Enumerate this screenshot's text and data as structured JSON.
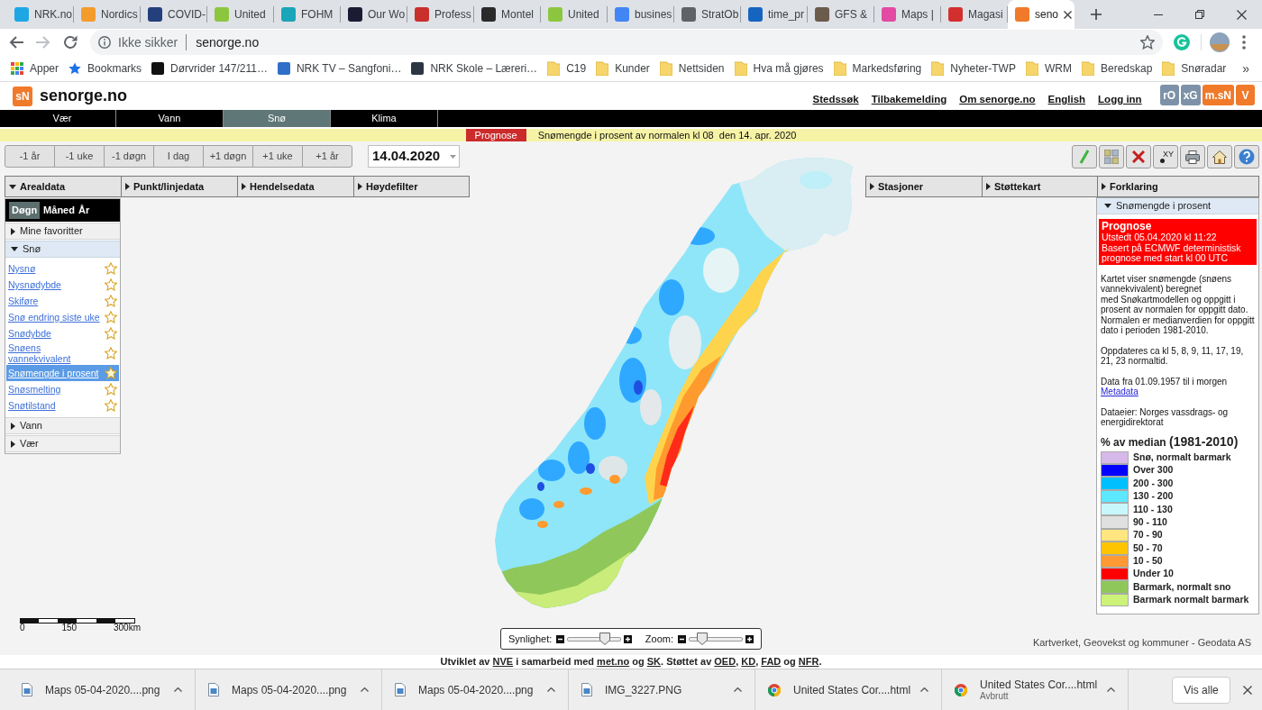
{
  "browser": {
    "tabs": [
      {
        "title": "NRK.no",
        "selected": false
      },
      {
        "title": "Nordics",
        "selected": false
      },
      {
        "title": "COVID-",
        "selected": false
      },
      {
        "title": "United",
        "selected": false
      },
      {
        "title": "FOHM",
        "selected": false
      },
      {
        "title": "Our Wo",
        "selected": false
      },
      {
        "title": "Profess",
        "selected": false
      },
      {
        "title": "Montel",
        "selected": false
      },
      {
        "title": "United",
        "selected": false
      },
      {
        "title": "busines",
        "selected": false
      },
      {
        "title": "StratOb",
        "selected": false
      },
      {
        "title": "time_pr",
        "selected": false
      },
      {
        "title": "GFS &",
        "selected": false
      },
      {
        "title": "Maps |",
        "selected": false
      },
      {
        "title": "Magasi",
        "selected": false
      },
      {
        "title": "seno",
        "selected": true
      }
    ],
    "address": {
      "security": "Ikke sikker",
      "url": "senorge.no"
    },
    "bookmarks": [
      {
        "kind": "apps",
        "label": "Apper"
      },
      {
        "kind": "star",
        "label": "Bookmarks"
      },
      {
        "kind": "site",
        "label": "Dørvrider 147/211…"
      },
      {
        "kind": "site",
        "label": "NRK TV – Sangfoni…"
      },
      {
        "kind": "site",
        "label": "NRK Skole – Læreri…"
      },
      {
        "kind": "folder",
        "label": "C19"
      },
      {
        "kind": "folder",
        "label": "Kunder"
      },
      {
        "kind": "folder",
        "label": "Nettsiden"
      },
      {
        "kind": "folder",
        "label": "Hva må gjøres"
      },
      {
        "kind": "folder",
        "label": "Markedsføring"
      },
      {
        "kind": "folder",
        "label": "Nyheter-TWP"
      },
      {
        "kind": "folder",
        "label": "WRM"
      },
      {
        "kind": "folder",
        "label": "Beredskap"
      },
      {
        "kind": "folder",
        "label": "Snøradar"
      }
    ],
    "bookmarks_more": "»"
  },
  "site": {
    "logo": "sN",
    "name": "senorge.no",
    "links": [
      "Stedssøk",
      "Tilbakemelding",
      "Om senorge.no",
      "English",
      "Logg inn"
    ],
    "apps": [
      {
        "label": "rO",
        "color": "#7d92a8"
      },
      {
        "label": "xG",
        "color": "#7d92a8"
      },
      {
        "label": "m.sN",
        "color": "#f07a2a"
      },
      {
        "label": "V",
        "color": "#f07a2a"
      }
    ]
  },
  "nav": [
    {
      "label": "Vær",
      "selected": false
    },
    {
      "label": "Vann",
      "selected": false
    },
    {
      "label": "Snø",
      "selected": true
    },
    {
      "label": "Klima",
      "selected": false
    }
  ],
  "notice": {
    "badge": "Prognose",
    "text": "Snømengde i prosent av normalen kl 08  den 14. apr. 2020"
  },
  "time_buttons": [
    "-1 år",
    "-1 uke",
    "-1 døgn",
    "I dag",
    "+1 døgn",
    "+1 uke",
    "+1 år"
  ],
  "date": "14.04.2020",
  "toolbar": [
    {
      "kind": "draw"
    },
    {
      "kind": "layers"
    },
    {
      "kind": "clear"
    },
    {
      "kind": "coords",
      "label": "XY"
    },
    {
      "kind": "print"
    },
    {
      "kind": "home"
    },
    {
      "kind": "help"
    }
  ],
  "menus_left": [
    {
      "label": "Arealdata",
      "expanded": true
    },
    {
      "label": "Punkt/linjedata",
      "expanded": false
    },
    {
      "label": "Hendelsedata",
      "expanded": false
    },
    {
      "label": "Høydefilter",
      "expanded": false
    }
  ],
  "menus_right": [
    {
      "label": "Stasjoner",
      "expanded": false
    },
    {
      "label": "Støttekart",
      "expanded": false
    },
    {
      "label": "Forklaring",
      "expanded": false
    }
  ],
  "periods": [
    {
      "label": "Døgn",
      "selected": true
    },
    {
      "label": "Måned",
      "selected": false
    },
    {
      "label": "År",
      "selected": false
    }
  ],
  "sections": [
    {
      "label": "Mine favoritter",
      "expanded": false
    },
    {
      "label": "Snø",
      "expanded": true,
      "children": [
        {
          "label": "Nysnø",
          "selected": false
        },
        {
          "label": "Nysnødybde",
          "selected": false
        },
        {
          "label": "Skiføre",
          "selected": false
        },
        {
          "label": "Snø endring siste uke",
          "selected": false
        },
        {
          "label": "Snødybde",
          "selected": false
        },
        {
          "label": "Snøens vannekvivalent",
          "selected": false
        },
        {
          "label": "Snømengde i prosent",
          "selected": true
        },
        {
          "label": "Snøsmelting",
          "selected": false
        },
        {
          "label": "Snøtilstand",
          "selected": false
        }
      ]
    },
    {
      "label": "Vann",
      "expanded": false
    },
    {
      "label": "Vær",
      "expanded": false
    }
  ],
  "info_panel": {
    "title": "Snømengde i prosent",
    "expanded": true,
    "alert": {
      "title": "Prognose",
      "lines": [
        "Utstedt 05.04.2020 kl 11:22",
        "Basert på ECMWF deterministisk prognose med start kl 00 UTC"
      ]
    },
    "description": [
      "Kartet viser snømengde (snøens vannekvivalent) beregnet",
      "med Snøkartmodellen og oppgitt i prosent av normalen for oppgitt dato. Normalen er medianverdien for oppgitt dato i perioden 1981-2010."
    ],
    "update_note": "Oppdateres ca kl 5, 8, 9, 11, 17, 19, 21, 23 normaltid.",
    "data_range": "Data fra 01.09.1957 til i morgen",
    "metadata_link": "Metadata",
    "owner": "Dataeier: Norges vassdrags- og energidirektorat",
    "legend_title": "% av median",
    "legend_period": "(1981-2010)",
    "legend": [
      {
        "label": "Snø, normalt barmark",
        "color": "#d7b8ea"
      },
      {
        "label": "Over 300",
        "color": "#0000ff"
      },
      {
        "label": "200 - 300",
        "color": "#00bfff"
      },
      {
        "label": "130 - 200",
        "color": "#5ce8ff"
      },
      {
        "label": "110 - 130",
        "color": "#c8f7fb"
      },
      {
        "label": "90 - 110",
        "color": "#e0e0e0"
      },
      {
        "label": "70 - 90",
        "color": "#ffe680"
      },
      {
        "label": "50 - 70",
        "color": "#ffc400"
      },
      {
        "label": "10 - 50",
        "color": "#ff9933"
      },
      {
        "label": "Under 10",
        "color": "#ff0000"
      },
      {
        "label": "Barmark, normalt sno",
        "color": "#8fc75a"
      },
      {
        "label": "Barmark normalt barmark",
        "color": "#ccf277"
      }
    ]
  },
  "scale": [
    "0",
    "150",
    "300km"
  ],
  "sliders": [
    {
      "label": "Synlighet:",
      "level": 0.7
    },
    {
      "label": "Zoom:",
      "level": 0.25
    }
  ],
  "attribution": "Kartverket, Geovekst og kommuner - Geodata AS",
  "footer": [
    {
      "text": "Utviklet av ",
      "link": false
    },
    {
      "text": "NVE",
      "link": true
    },
    {
      "text": " i samarbeid med ",
      "link": false
    },
    {
      "text": "met.no",
      "link": true
    },
    {
      "text": " og ",
      "link": false
    },
    {
      "text": "SK",
      "link": true
    },
    {
      "text": ". Støttet av ",
      "link": false
    },
    {
      "text": "OED",
      "link": true
    },
    {
      "text": ", ",
      "link": false
    },
    {
      "text": "KD",
      "link": true
    },
    {
      "text": ", ",
      "link": false
    },
    {
      "text": "FAD",
      "link": true
    },
    {
      "text": " og ",
      "link": false
    },
    {
      "text": "NFR",
      "link": true
    },
    {
      "text": ".",
      "link": false
    }
  ],
  "downloads": {
    "items": [
      {
        "kind": "file",
        "name": "Maps 05-04-2020....png"
      },
      {
        "kind": "file",
        "name": "Maps 05-04-2020....png"
      },
      {
        "kind": "file",
        "name": "Maps 05-04-2020....png"
      },
      {
        "kind": "file",
        "name": "IMG_3227.PNG"
      },
      {
        "kind": "web",
        "name": "United States Cor....html"
      },
      {
        "kind": "web",
        "name": "United States Cor....html",
        "status": "Avbrutt"
      }
    ],
    "show_all": "Vis alle"
  }
}
